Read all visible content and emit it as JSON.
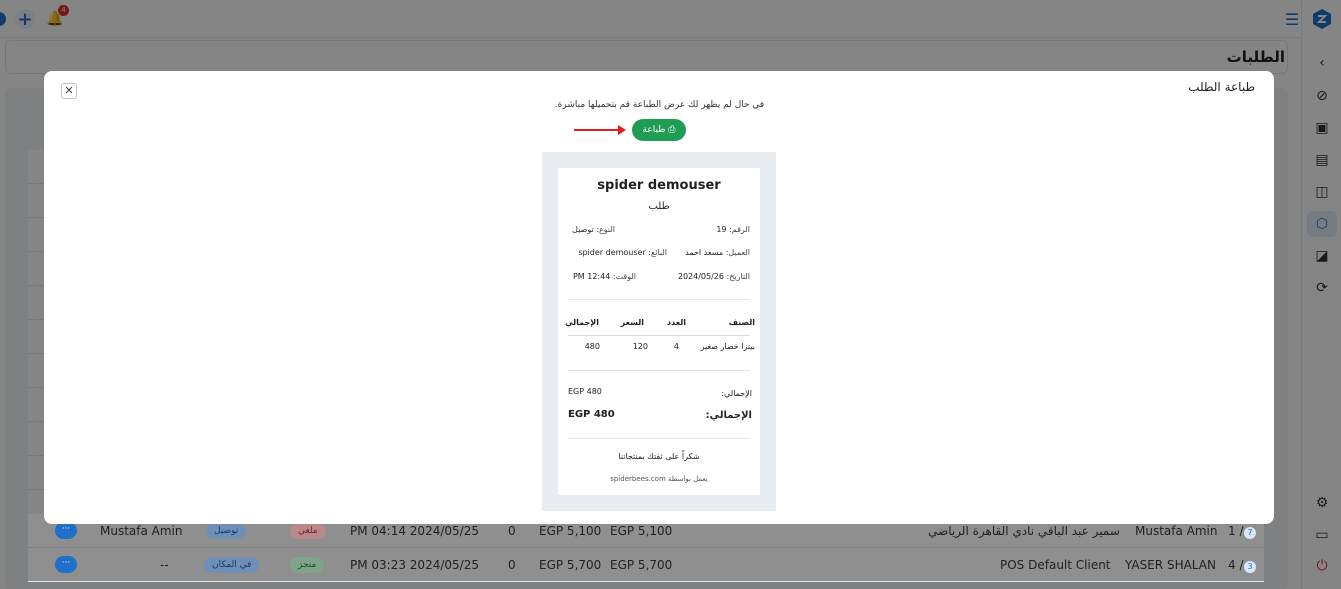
{
  "page": {
    "title": "الطلبات"
  },
  "topbar": {
    "notification_count": "4"
  },
  "sidebar": {
    "items": [
      "speed",
      "lock-bag",
      "board",
      "users-cart",
      "box",
      "user-settings",
      "sync",
      "settings",
      "monitor",
      "power"
    ]
  },
  "modal": {
    "title": "طباعة الطلب",
    "close": "✕",
    "note": "في حال لم يظهر لك عرض الطباعة قم بتحميلها مباشرة.",
    "print_label": "⎙ طباعة"
  },
  "receipt": {
    "store_name": "spider demouser",
    "order_type_heading": "طلب",
    "number_label": "الرقم:",
    "number_value": "19",
    "type_label": "النوع:",
    "type_value": "توصيل",
    "customer_label": "العميل:",
    "customer_value": "مسعد احمد",
    "seller_label": "البائع:",
    "seller_value": "spider demouser",
    "date_label": "التاريخ:",
    "date_value": "2024/05/26",
    "time_label": "الوقت:",
    "time_value": "PM 12:44",
    "table_headers": {
      "item": "الصنف",
      "qty": "العدد",
      "price": "السعر",
      "total": "الإجمالي"
    },
    "items": [
      {
        "name": "بيتزا خضار صغير",
        "qty": "4",
        "price": "120",
        "total": "480"
      }
    ],
    "subtotal_label": "الإجمالي:",
    "subtotal_value": "EGP 480",
    "grand_total_label": "الإجمالي:",
    "grand_total_value": "EGP 480",
    "thanks": "شكراً على ثقتك بمنتجاتنا",
    "powered_by": "يعمل بواسطة spiderbees.com"
  },
  "orders": [
    {
      "id": "7",
      "page": "1 /",
      "user": "Mustafa Amin",
      "client": "سمير عبد الباقي نادي القاهرة الرياضي",
      "total1": "EGP 5,100",
      "total2": "EGP 5,100",
      "paid": "0",
      "datetime": "PM 04:14 2024/05/25",
      "status": "ملغي",
      "type": "توصيل",
      "driver": "Mustafa Amin",
      "actions": "···"
    },
    {
      "id": "3",
      "page": "4 /",
      "user": "YASER SHALAN",
      "client": "POS Default Client",
      "total1": "EGP 5,700",
      "total2": "EGP 5,700",
      "paid": "0",
      "datetime": "PM 03:23 2024/05/25",
      "status": "منجز",
      "type": "في المكان",
      "driver": "--",
      "actions": "···"
    }
  ]
}
